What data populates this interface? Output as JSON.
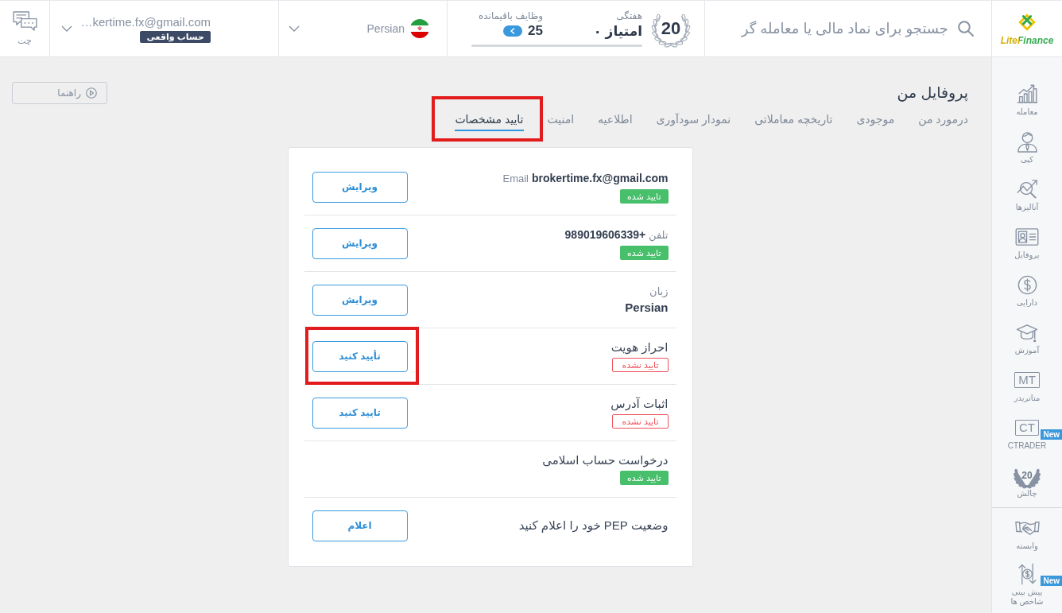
{
  "top_bar": {
    "logo": {
      "name": "LiteFinance"
    },
    "search": {
      "placeholder": "جستجو برای نماد مالی یا معامله گر"
    },
    "challenge": {
      "number": "20",
      "period": "هفتگی",
      "points": "۰ امتیاز",
      "tasks_label": "وظایف باقیمانده",
      "tasks_count": "25",
      "level": 0
    },
    "language": {
      "label": "Persian"
    },
    "account": {
      "email": "…kertime.fx@gmail.com",
      "type": "حساب واقعی"
    },
    "chat": {
      "label": "چت"
    }
  },
  "sidebar": {
    "groups": [
      {
        "items": [
          {
            "kind": "icon",
            "label": "معامله"
          },
          {
            "kind": "icon",
            "label": "کپی"
          },
          {
            "kind": "icon",
            "label": "آنالیزها"
          },
          {
            "kind": "icon",
            "label": "پروفایل"
          },
          {
            "kind": "icon",
            "label": "دارایی"
          },
          {
            "kind": "icon",
            "label": "آموزش"
          },
          {
            "kind": "boxed",
            "icon_text": "MT",
            "label": "متاتریدر"
          },
          {
            "kind": "boxed",
            "icon_text": "CT",
            "label": "CTRADER",
            "tag": "New"
          },
          {
            "kind": "laurel",
            "icon_text": "20",
            "label": "چالش"
          }
        ]
      },
      {
        "items": [
          {
            "kind": "icon",
            "label": "وابسته"
          },
          {
            "kind": "icon",
            "label": "پیش بینی شاخص ها",
            "tag": "New"
          }
        ]
      }
    ]
  },
  "page": {
    "title": "پروفایل من",
    "guide_button": "راهنما",
    "tabs": [
      {
        "label": "درمورد من",
        "selected": false,
        "highlighted": false
      },
      {
        "label": "موجودی",
        "selected": false,
        "highlighted": false
      },
      {
        "label": "تاریخچه معاملاتی",
        "selected": false,
        "highlighted": false
      },
      {
        "label": "نمودار سودآوری",
        "selected": false,
        "highlighted": false
      },
      {
        "label": "اطلاعیه",
        "selected": false,
        "highlighted": false
      },
      {
        "label": "امنیت",
        "selected": false,
        "highlighted": false
      },
      {
        "label": "تایید مشخصات",
        "selected": true,
        "highlighted": true
      }
    ],
    "rows": [
      {
        "kind": "inline",
        "label": "Email",
        "value": "brokertime.fx@gmail.com",
        "status": {
          "text": "تایید شده",
          "verified": true
        },
        "button": {
          "label": "ویرایش",
          "highlighted": false
        }
      },
      {
        "kind": "inline",
        "label": "تلفن",
        "value": "+989019606339",
        "status": {
          "text": "تایید شده",
          "verified": true
        },
        "button": {
          "label": "ویرایش",
          "highlighted": false
        }
      },
      {
        "kind": "stacked",
        "label": "زبان",
        "value": "Persian",
        "button": {
          "label": "ویرایش",
          "highlighted": false
        }
      },
      {
        "kind": "title",
        "title": "احراز هویت",
        "status": {
          "text": "تایید نشده",
          "verified": false
        },
        "button": {
          "label": "تأیید کنید",
          "highlighted": true
        }
      },
      {
        "kind": "title",
        "title": "اثبات آدرس",
        "status": {
          "text": "تایید نشده",
          "verified": false
        },
        "button": {
          "label": "تایید کنید",
          "highlighted": false
        }
      },
      {
        "kind": "title",
        "title": "درخواست حساب اسلامی",
        "status": {
          "text": "تایید شده",
          "verified": true
        }
      },
      {
        "kind": "title",
        "title": "وضعیت PEP خود را اعلام کنید",
        "button": {
          "label": "اعلام",
          "highlighted": false
        }
      }
    ]
  }
}
